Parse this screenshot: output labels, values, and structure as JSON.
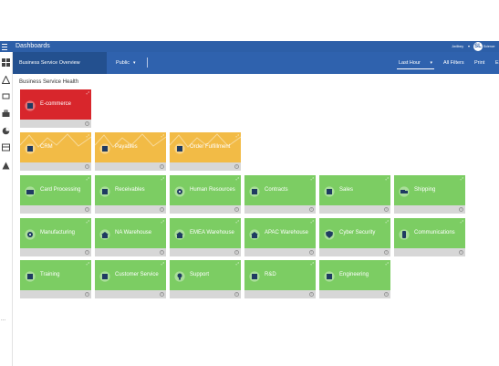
{
  "header": {
    "title": "Dashboards",
    "user": "Jwilbey",
    "user_caret": "▾",
    "logo_mark": "SL",
    "logo_text": "Science"
  },
  "toolbar": {
    "dashboard_tab": "Business Service Overview",
    "visibility": "Public",
    "visibility_caret": "▾",
    "time_range": "Last Hour",
    "time_caret": "▾",
    "all_filters": "All Filters",
    "print": "Print",
    "edit": "E"
  },
  "rail": {
    "more": "···"
  },
  "section": {
    "title": "Business Service Health"
  },
  "colors": {
    "healthy": "#7ccd63",
    "warning": "#f2bb46",
    "critical": "#d8262c",
    "header": "#2d5fa8"
  },
  "tiles": [
    {
      "label": "E-commerce",
      "status": "critical",
      "icon": "globe-cart-icon"
    },
    {
      "label": "CRM",
      "status": "warning",
      "icon": "monitor-people-icon"
    },
    {
      "label": "Payables",
      "status": "warning",
      "icon": "pen-invoice-icon"
    },
    {
      "label": "Order Fulfillment",
      "status": "warning",
      "icon": "stacked-boxes-icon"
    },
    {
      "label": "Card Processing",
      "status": "healthy",
      "icon": "credit-card-icon"
    },
    {
      "label": "Receivables",
      "status": "healthy",
      "icon": "money-icon"
    },
    {
      "label": "Human Resources",
      "status": "healthy",
      "icon": "people-gear-icon"
    },
    {
      "label": "Contracts",
      "status": "healthy",
      "icon": "handshake-icon"
    },
    {
      "label": "Sales",
      "status": "healthy",
      "icon": "sales-tag-icon"
    },
    {
      "label": "Shipping",
      "status": "healthy",
      "icon": "truck-icon"
    },
    {
      "label": "Manufacturing",
      "status": "healthy",
      "icon": "gear-wrench-icon"
    },
    {
      "label": "NA Warehouse",
      "status": "healthy",
      "icon": "warehouse-icon"
    },
    {
      "label": "EMEA Warehouse",
      "status": "healthy",
      "icon": "warehouse-icon"
    },
    {
      "label": "APAC Warehouse",
      "status": "healthy",
      "icon": "warehouse-icon"
    },
    {
      "label": "Cyber Security",
      "status": "healthy",
      "icon": "shield-icon"
    },
    {
      "label": "Communications",
      "status": "healthy",
      "icon": "phone-icon"
    },
    {
      "label": "Training",
      "status": "healthy",
      "icon": "presentation-icon"
    },
    {
      "label": "Customer Service",
      "status": "healthy",
      "icon": "headset-agent-icon"
    },
    {
      "label": "Support",
      "status": "healthy",
      "icon": "lightbulb-icon"
    },
    {
      "label": "R&D",
      "status": "healthy",
      "icon": "research-chart-icon"
    },
    {
      "label": "Engineering",
      "status": "healthy",
      "icon": "hardhat-icon"
    }
  ]
}
